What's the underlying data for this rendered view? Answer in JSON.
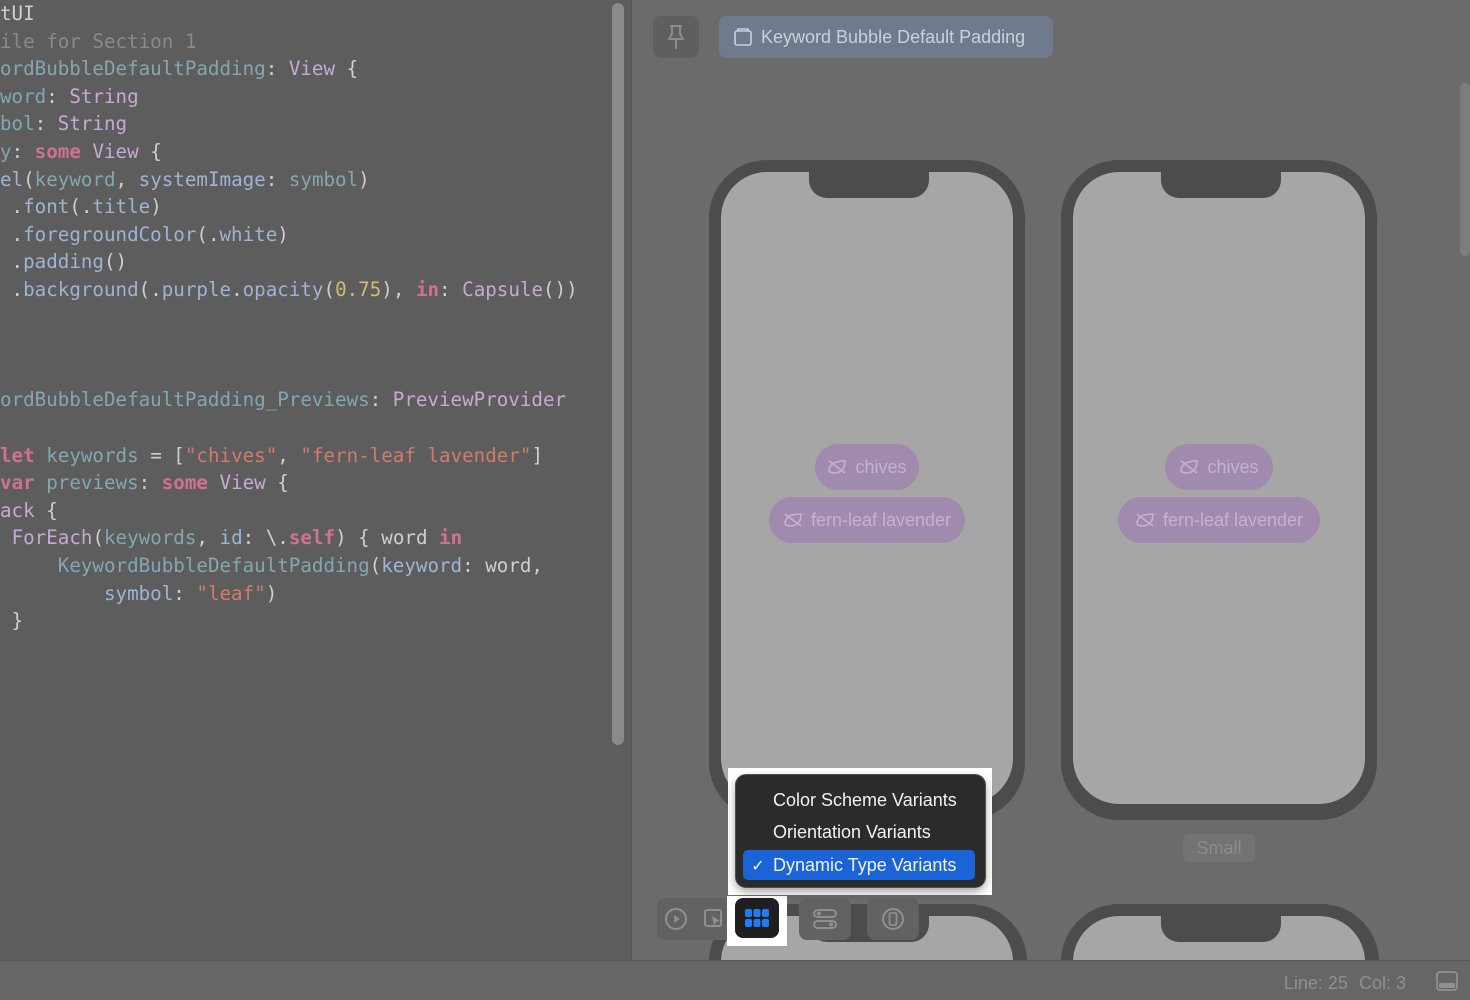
{
  "editor": {
    "lines": [
      [
        [
          "plain",
          "tUI"
        ]
      ],
      [
        [
          "comment",
          "ile for Section 1"
        ]
      ],
      [
        [
          "decl",
          "ordBubbleDefaultPadding"
        ],
        [
          "plain",
          ": "
        ],
        [
          "type",
          "View"
        ],
        [
          "plain",
          " {"
        ]
      ],
      [
        [
          "decl",
          "word"
        ],
        [
          "plain",
          ": "
        ],
        [
          "type",
          "String"
        ]
      ],
      [
        [
          "decl",
          "bol"
        ],
        [
          "plain",
          ": "
        ],
        [
          "type",
          "String"
        ]
      ],
      [
        [
          "decl",
          "y"
        ],
        [
          "plain",
          ": "
        ],
        [
          "kw",
          "some"
        ],
        [
          "plain",
          " "
        ],
        [
          "type",
          "View"
        ],
        [
          "plain",
          " {"
        ]
      ],
      [
        [
          "member",
          "el"
        ],
        [
          "plain",
          "("
        ],
        [
          "decl",
          "keyword"
        ],
        [
          "plain",
          ", "
        ],
        [
          "member",
          "systemImage"
        ],
        [
          "plain",
          ": "
        ],
        [
          "decl",
          "symbol"
        ],
        [
          "plain",
          ")"
        ]
      ],
      [
        [
          "plain",
          " ."
        ],
        [
          "member",
          "font"
        ],
        [
          "plain",
          "(."
        ],
        [
          "member",
          "title"
        ],
        [
          "plain",
          ")"
        ]
      ],
      [
        [
          "plain",
          " ."
        ],
        [
          "member",
          "foregroundColor"
        ],
        [
          "plain",
          "(."
        ],
        [
          "member",
          "white"
        ],
        [
          "plain",
          ")"
        ]
      ],
      [
        [
          "plain",
          " ."
        ],
        [
          "member",
          "padding"
        ],
        [
          "plain",
          "()"
        ]
      ],
      [
        [
          "plain",
          " ."
        ],
        [
          "member",
          "background"
        ],
        [
          "plain",
          "(."
        ],
        [
          "member",
          "purple"
        ],
        [
          "plain",
          "."
        ],
        [
          "member",
          "opacity"
        ],
        [
          "plain",
          "("
        ],
        [
          "num",
          "0.75"
        ],
        [
          "plain",
          "), "
        ],
        [
          "kw",
          "in"
        ],
        [
          "plain",
          ": "
        ],
        [
          "type",
          "Capsule"
        ],
        [
          "plain",
          "())"
        ]
      ],
      [],
      [],
      [],
      [
        [
          "decl",
          "ordBubbleDefaultPadding_Previews"
        ],
        [
          "plain",
          ": "
        ],
        [
          "type",
          "PreviewProvider"
        ]
      ],
      [],
      [
        [
          "kw",
          "let"
        ],
        [
          "plain",
          " "
        ],
        [
          "decl",
          "keywords"
        ],
        [
          "plain",
          " = ["
        ],
        [
          "str",
          "\"chives\""
        ],
        [
          "plain",
          ", "
        ],
        [
          "str",
          "\"fern-leaf lavender\""
        ],
        [
          "plain",
          "]"
        ]
      ],
      [
        [
          "kw",
          "var"
        ],
        [
          "plain",
          " "
        ],
        [
          "decl",
          "previews"
        ],
        [
          "plain",
          ": "
        ],
        [
          "kw",
          "some"
        ],
        [
          "plain",
          " "
        ],
        [
          "type",
          "View"
        ],
        [
          "plain",
          " {"
        ]
      ],
      [
        [
          "type",
          "ack"
        ],
        [
          "plain",
          " {"
        ]
      ],
      [
        [
          "plain",
          " "
        ],
        [
          "type",
          "ForEach"
        ],
        [
          "plain",
          "("
        ],
        [
          "decl",
          "keywords"
        ],
        [
          "plain",
          ", "
        ],
        [
          "member",
          "id"
        ],
        [
          "plain",
          ": \\."
        ],
        [
          "kw",
          "self"
        ],
        [
          "plain",
          ") { word "
        ],
        [
          "kw",
          "in"
        ]
      ],
      [
        [
          "plain",
          "     "
        ],
        [
          "decl",
          "KeywordBubbleDefaultPadding"
        ],
        [
          "plain",
          "("
        ],
        [
          "member",
          "keyword"
        ],
        [
          "plain",
          ": word,"
        ]
      ],
      [
        [
          "plain",
          "         "
        ],
        [
          "member",
          "symbol"
        ],
        [
          "plain",
          ": "
        ],
        [
          "str",
          "\"leaf\""
        ],
        [
          "plain",
          ")"
        ]
      ],
      [
        [
          "plain",
          " }"
        ]
      ]
    ]
  },
  "canvas": {
    "pin_icon": "pin-icon",
    "preview_tab": {
      "icon": "preview-window-icon",
      "label": "Keyword Bubble Default Padding"
    },
    "bubbles": {
      "first": "chives",
      "second": "fern-leaf lavender",
      "icon": "leaf-slash-icon"
    },
    "variant_label": "Small"
  },
  "toolbar": {
    "live_icon": "play-icon",
    "select_icon": "selectable-cursor-icon",
    "variants_icon": "variants-grid-icon",
    "settings_icon": "device-settings-icon",
    "device_icon": "device-icon"
  },
  "menu": {
    "items": [
      {
        "label": "Color Scheme Variants",
        "selected": false
      },
      {
        "label": "Orientation Variants",
        "selected": false
      },
      {
        "label": "Dynamic Type Variants",
        "selected": true
      }
    ],
    "check": "✓"
  },
  "status": {
    "line": "Line: 25",
    "col": "Col: 3"
  },
  "colors": {
    "selection": "#1b64d8",
    "bubble": "#a08aad",
    "screen": "#a6a6a6"
  }
}
